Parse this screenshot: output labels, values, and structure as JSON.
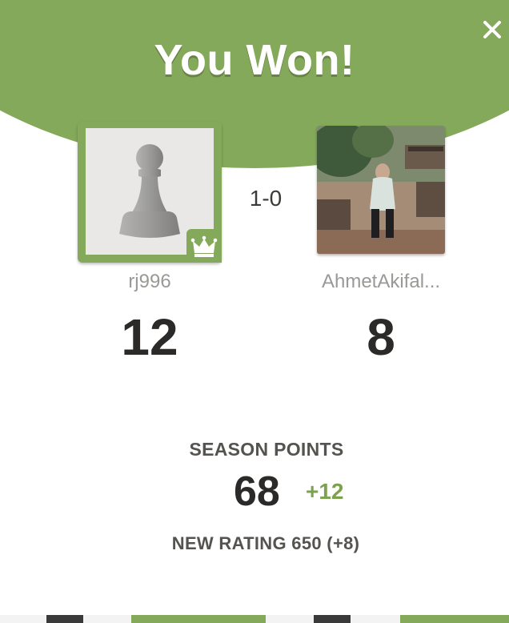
{
  "modal": {
    "title": "You Won!",
    "close_icon": "close-icon"
  },
  "match": {
    "score": "1-0"
  },
  "players": {
    "winner": {
      "username": "rj996",
      "rating": "12",
      "avatar_icon": "pawn-icon",
      "badge_icon": "crown-icon"
    },
    "opponent": {
      "username": "AhmetAkifal...",
      "rating": "8",
      "avatar": "profile-photo"
    }
  },
  "season": {
    "label": "SEASON POINTS",
    "points": "68",
    "delta": "+12"
  },
  "new_rating": {
    "text": "NEW RATING 650 (+8)"
  },
  "colors": {
    "accent_green": "#85a95a",
    "delta_green": "#7ca14f"
  }
}
